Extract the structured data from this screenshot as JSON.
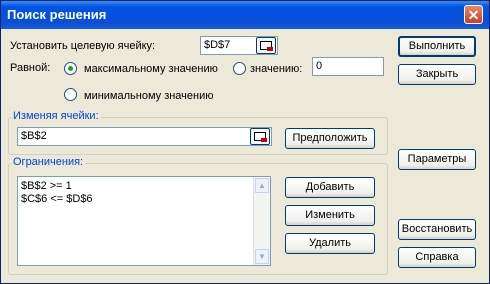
{
  "window": {
    "title": "Поиск решения"
  },
  "target": {
    "label": "Установить целевую ячейку:",
    "value": "$D$7"
  },
  "equal": {
    "label": "Равной:",
    "max_label": "максимальному значению",
    "value_label": "значению:",
    "value_input": "0",
    "min_label": "минимальному значению",
    "selected": "max"
  },
  "changing": {
    "label": "Изменяя ячейки:",
    "value": "$B$2",
    "guess_button": "Предположить"
  },
  "constraints": {
    "label": "Ограничения:",
    "items": [
      "$B$2 >= 1",
      "$C$6 <= $D$6"
    ],
    "add_button": "Добавить",
    "change_button": "Изменить",
    "delete_button": "Удалить"
  },
  "right_buttons": {
    "run": "Выполнить",
    "close": "Закрыть",
    "options": "Параметры",
    "reset": "Восстановить",
    "help": "Справка"
  }
}
